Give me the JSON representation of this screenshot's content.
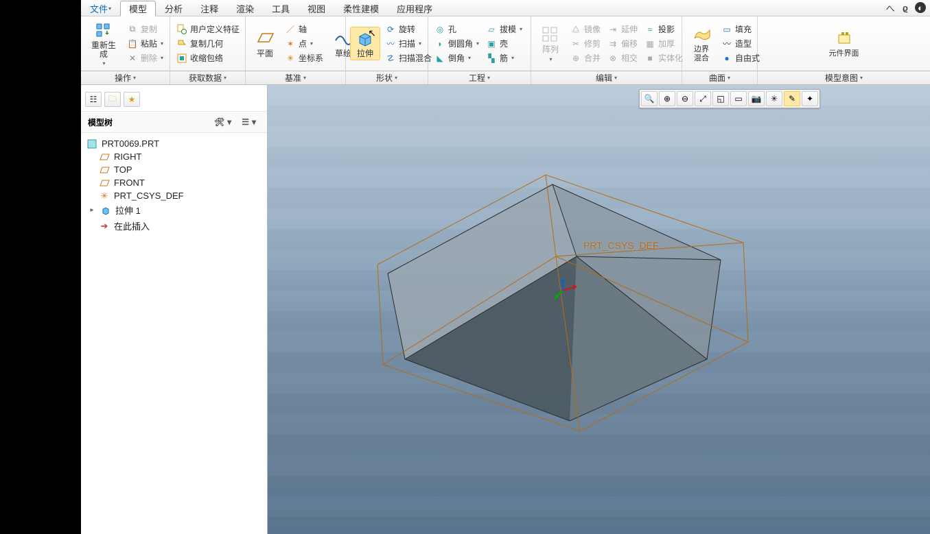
{
  "menu": {
    "file": "文件",
    "tabs": [
      "模型",
      "分析",
      "注释",
      "渲染",
      "工具",
      "视图",
      "柔性建模",
      "应用程序"
    ]
  },
  "ribbon": {
    "op": {
      "regen": "重新生成",
      "copy": "复制",
      "paste": "粘贴",
      "delete": "删除",
      "udf": "用户定义特征",
      "copyGeom": "复制几何",
      "shrinkwrap": "收缩包络"
    },
    "datum": {
      "plane": "平面",
      "axis": "轴",
      "point": "点",
      "csys": "坐标系",
      "sketch": "草绘"
    },
    "shape": {
      "extrude": "拉伸",
      "revolve": "旋转",
      "sweep": "扫描",
      "sweptBlend": "扫描混合"
    },
    "eng": {
      "hole": "孔",
      "round": "倒圆角",
      "chamfer": "倒角",
      "draft": "拔模",
      "shell": "壳",
      "rib": "筋"
    },
    "pattern": "阵列",
    "edit": {
      "mirror": "镜像",
      "trim": "修剪",
      "merge": "合并",
      "extend": "延伸",
      "offset": "偏移",
      "intersect": "相交",
      "thicken": "加厚",
      "solidify": "实体化",
      "project": "投影"
    },
    "surface": {
      "boundary": "边界混合",
      "fill": "填充",
      "style": "造型",
      "freeform": "自由式"
    },
    "compIface": "元件界面"
  },
  "subrow": {
    "operate": "操作",
    "getdata": "获取数据",
    "datum": "基准",
    "shape": "形状",
    "engineering": "工程",
    "edit": "编辑",
    "surfaces": "曲面",
    "modelIntent": "模型意图"
  },
  "tree": {
    "title": "模型树",
    "root": "PRT0069.PRT",
    "nodes": {
      "right": "RIGHT",
      "top": "TOP",
      "front": "FRONT",
      "csys": "PRT_CSYS_DEF",
      "extrude1": "拉伸 1",
      "insertHere": "在此插入"
    }
  },
  "viewport": {
    "csysLabel": "PRT_CSYS_DEF"
  }
}
